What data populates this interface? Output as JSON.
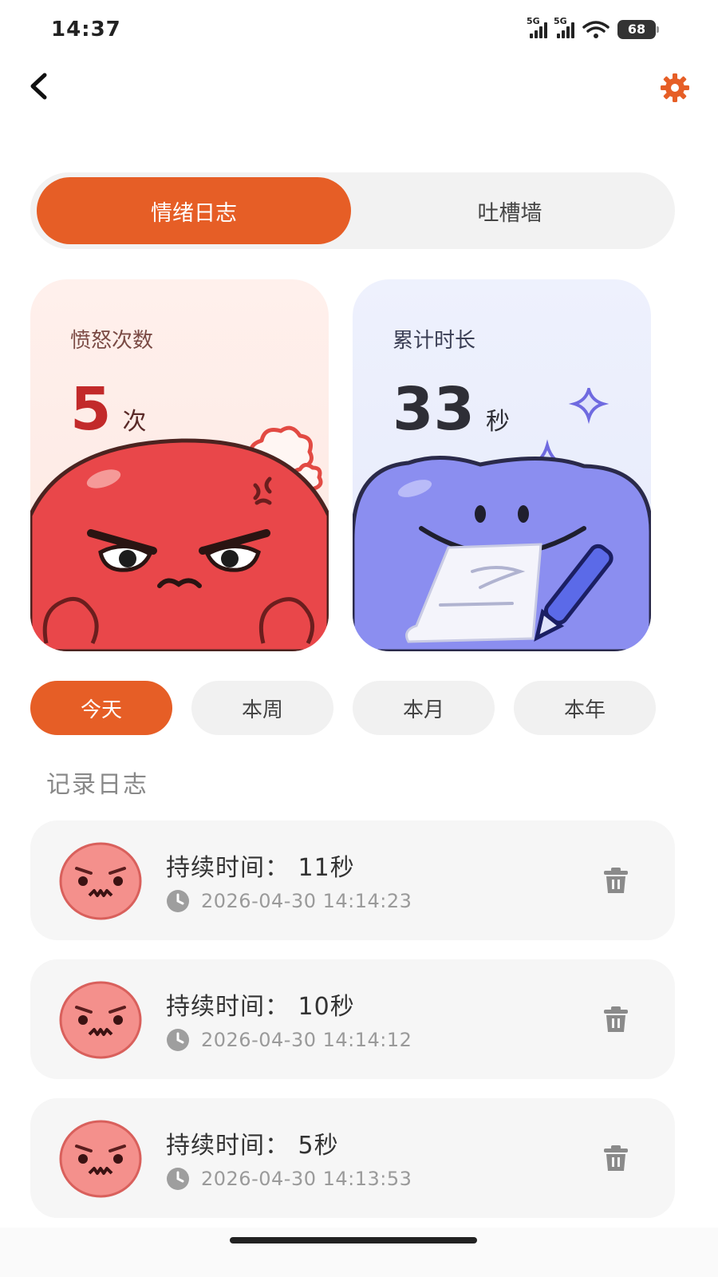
{
  "status_bar": {
    "time": "14:37",
    "signal_1_label": "5G",
    "signal_2_label": "5G",
    "wifi_icon": "wifi-icon",
    "battery": "68"
  },
  "header": {
    "back_icon": "chevron-left-icon",
    "settings_icon": "gear-icon",
    "accent_color": "#e65e26"
  },
  "tabs": [
    {
      "label": "情绪日志",
      "active": true
    },
    {
      "label": "吐槽墙",
      "active": false
    }
  ],
  "stats": {
    "anger": {
      "label": "愤怒次数",
      "value": "5",
      "unit": "次"
    },
    "duration": {
      "label": "累计时长",
      "value": "33",
      "unit": "秒"
    }
  },
  "periods": [
    {
      "label": "今天",
      "active": true
    },
    {
      "label": "本周",
      "active": false
    },
    {
      "label": "本月",
      "active": false
    },
    {
      "label": "本年",
      "active": false
    }
  ],
  "section_title": "记录日志",
  "logs": [
    {
      "title": "持续时间：  11秒",
      "timestamp": "2026-04-30 14:14:23"
    },
    {
      "title": "持续时间：  10秒",
      "timestamp": "2026-04-30 14:14:12"
    },
    {
      "title": "持续时间：  5秒",
      "timestamp": "2026-04-30 14:13:53"
    }
  ]
}
